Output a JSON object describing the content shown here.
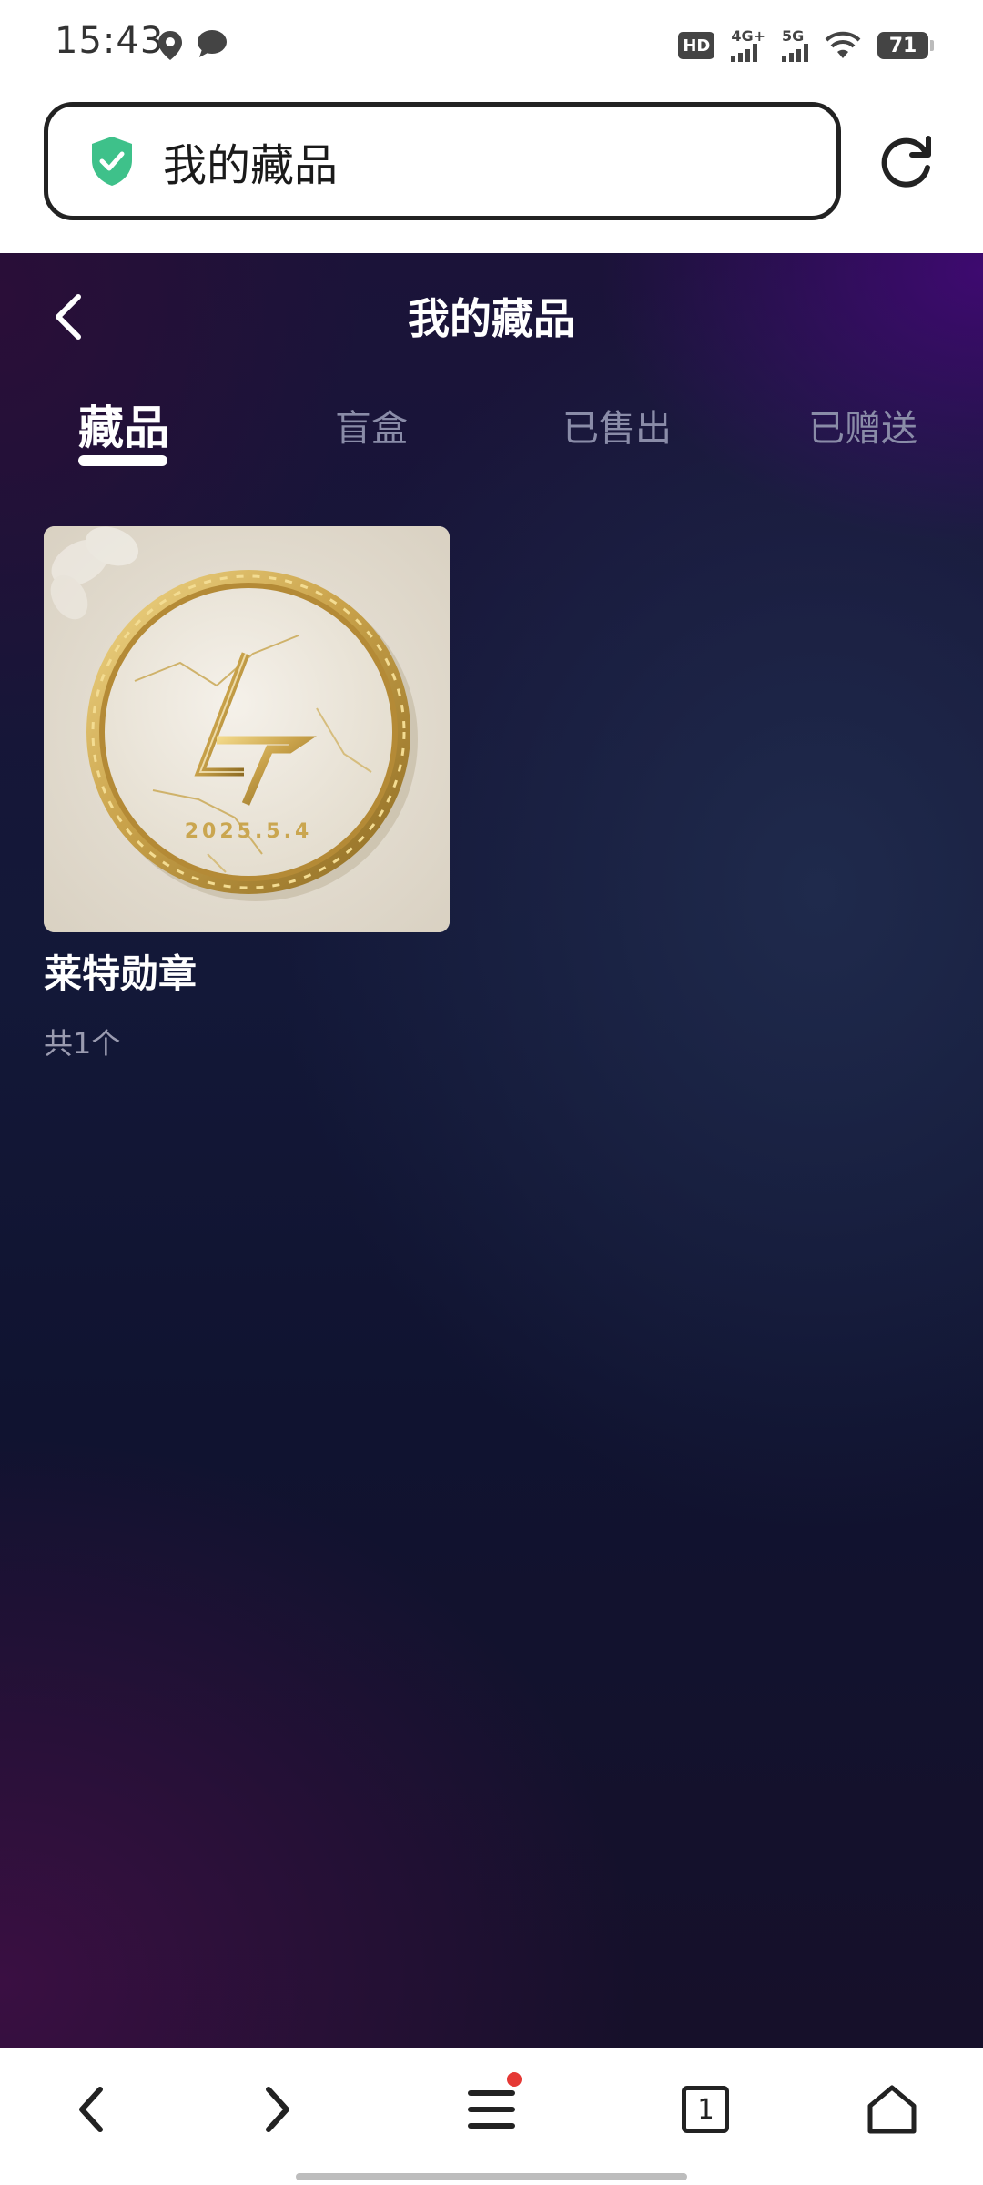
{
  "status_bar": {
    "time": "15:43",
    "left_icons": [
      "location-icon",
      "chat-bubble-icon"
    ],
    "hd_label": "HD",
    "network_1": "4G+",
    "network_2": "5G",
    "battery": "71"
  },
  "browser": {
    "address_text": "我的藏品",
    "secure_icon": "shield-check-icon",
    "reload_icon": "reload-icon"
  },
  "page": {
    "title": "我的藏品",
    "tabs": [
      {
        "label": "藏品",
        "active": true
      },
      {
        "label": "盲盒",
        "active": false
      },
      {
        "label": "已售出",
        "active": false
      },
      {
        "label": "已赠送",
        "active": false
      }
    ],
    "items": [
      {
        "name": "莱特勋章",
        "count": "共1个",
        "medal_date": "2025.5.4",
        "medal_monogram": "LT"
      }
    ]
  },
  "bottom_nav": {
    "tab_count": "1",
    "has_notification_dot": true
  },
  "colors": {
    "accent_shield": "#3ec18a",
    "notification": "#e53935",
    "gold": "#c9a24a"
  }
}
